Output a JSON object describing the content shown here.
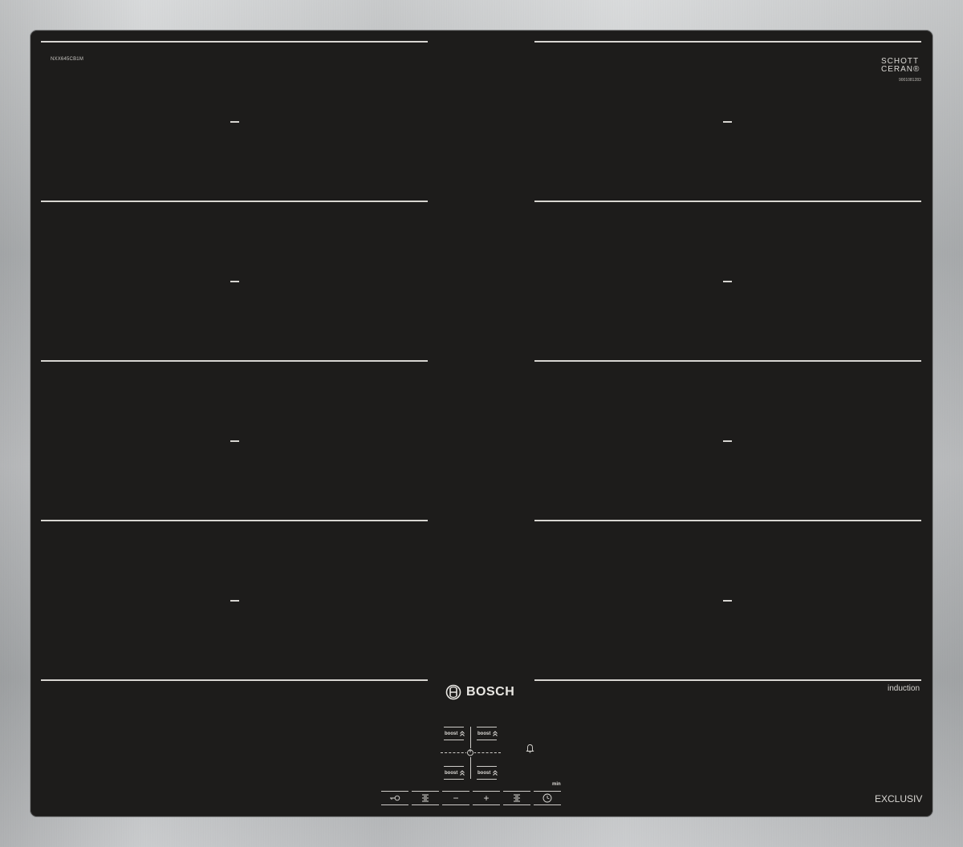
{
  "model_code": "NXX645CB1M",
  "glass_brand": {
    "line1": "SCHOTT",
    "line2": "CERAN®",
    "code": "9001081283"
  },
  "cooktop": {
    "left_zones": [
      "–",
      "–",
      "–",
      "–"
    ],
    "right_zones": [
      "–",
      "–",
      "–",
      "–"
    ]
  },
  "brand": {
    "name": "BOSCH",
    "icon": "bosch-armature-logo-icon"
  },
  "type_label": "induction",
  "series_label": "EXCLUSIV",
  "controls": {
    "boost_buttons": [
      {
        "label": "boost",
        "icon": "double-chevron-up-icon"
      },
      {
        "label": "boost",
        "icon": "double-chevron-up-icon"
      },
      {
        "label": "boost",
        "icon": "double-chevron-up-icon"
      },
      {
        "label": "boost",
        "icon": "double-chevron-up-icon"
      }
    ],
    "power_icon": "power-icon",
    "bell_icon": "bell-icon",
    "timer_unit": "min",
    "bottom_buttons": [
      {
        "name": "key-lock-button",
        "icon": "key-icon"
      },
      {
        "name": "zone-select-left-button",
        "icon": "zone-levels-icon"
      },
      {
        "name": "minus-button",
        "icon": "minus-icon",
        "glyph": "−"
      },
      {
        "name": "plus-button",
        "icon": "plus-icon",
        "glyph": "+"
      },
      {
        "name": "zone-select-right-button",
        "icon": "zone-levels-icon"
      },
      {
        "name": "timer-button",
        "icon": "clock-icon"
      }
    ]
  }
}
